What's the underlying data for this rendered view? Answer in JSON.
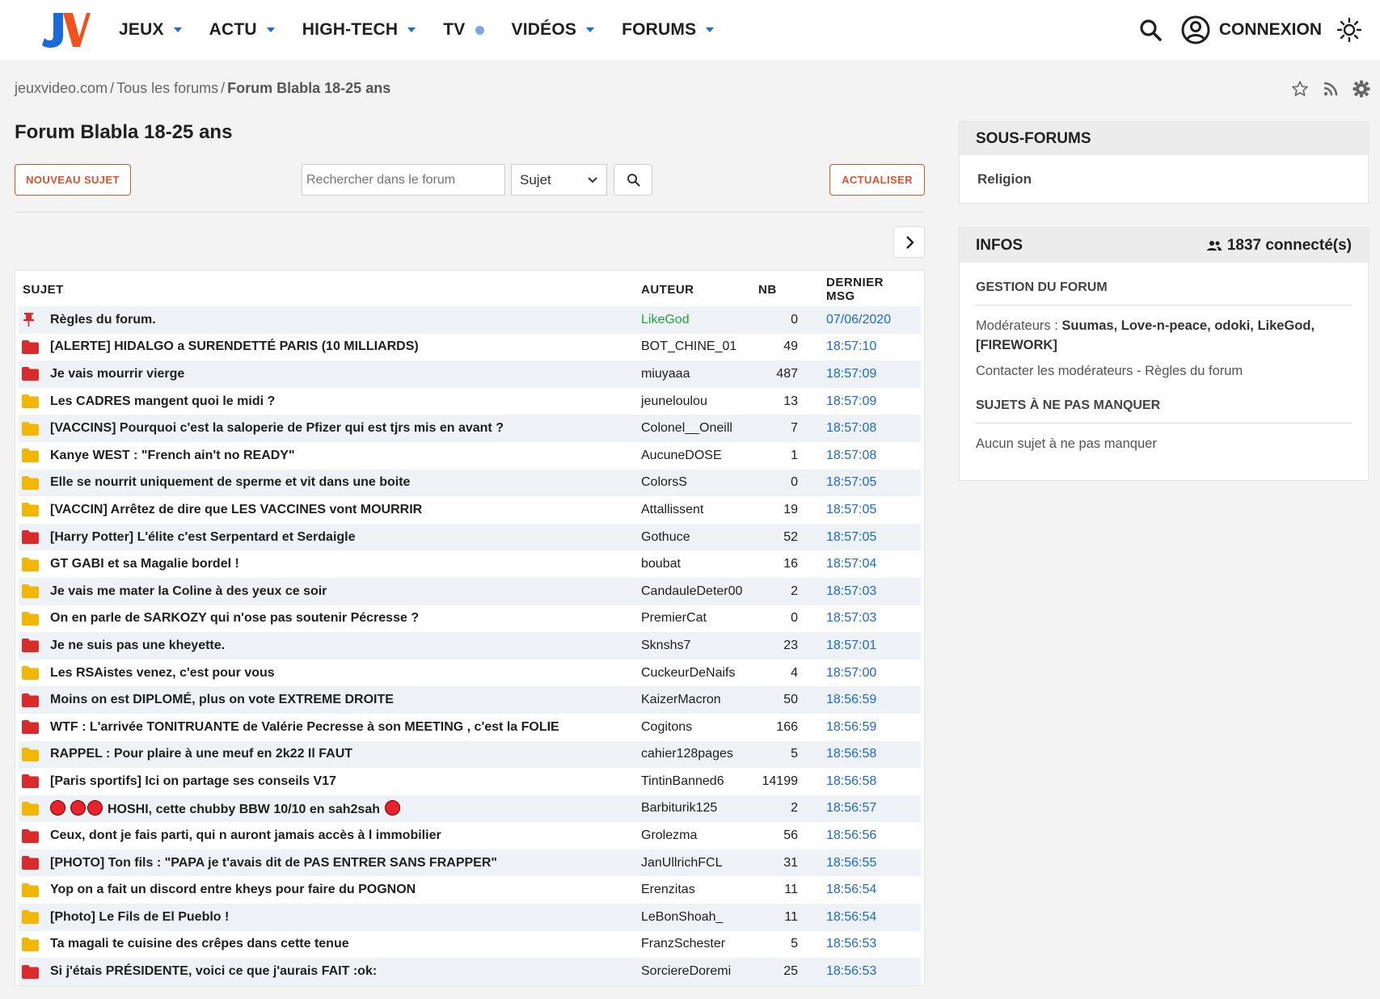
{
  "header": {
    "logo_text": "JV",
    "nav": [
      {
        "label": "JEUX",
        "marker": "caret"
      },
      {
        "label": "ACTU",
        "marker": "caret"
      },
      {
        "label": "HIGH-TECH",
        "marker": "caret"
      },
      {
        "label": "TV",
        "marker": "dot"
      },
      {
        "label": "VIDÉOS",
        "marker": "caret"
      },
      {
        "label": "FORUMS",
        "marker": "caret"
      }
    ],
    "login_label": "CONNEXION",
    "icons": [
      "search-icon",
      "user-icon",
      "sun-icon"
    ],
    "accent_color": "#1a6ad8"
  },
  "breadcrumb": {
    "items": [
      "jeuxvideo.com",
      "Tous les forums"
    ],
    "separator": "/",
    "current": "Forum Blabla 18-25 ans"
  },
  "page_title": "Forum Blabla 18-25 ans",
  "controls": {
    "new_topic": "NOUVEAU SUJET",
    "search_placeholder": "Rechercher dans le forum",
    "search_mode": "Sujet",
    "refresh": "ACTUALISER",
    "button_color": "#e0522b"
  },
  "table": {
    "headers": {
      "subject": "SUJET",
      "author": "AUTEUR",
      "count": "NB",
      "last": "DERNIER MSG"
    },
    "rows": [
      {
        "icon": "pin",
        "subject": "Règles du forum.",
        "author": "LikeGod",
        "count": "0",
        "last": "07/06/2020",
        "author_color": "green"
      },
      {
        "icon": "red",
        "subject": "[ALERTE] HIDALGO a SURENDETTÉ PARIS (10 MILLIARDS)",
        "author": "BOT_CHINE_01",
        "count": "49",
        "last": "18:57:10"
      },
      {
        "icon": "red",
        "subject": "Je vais mourrir vierge",
        "author": "miuyaaa",
        "count": "487",
        "last": "18:57:09"
      },
      {
        "icon": "yellow",
        "subject": "Les CADRES mangent quoi le midi ?",
        "author": "jeuneloulou",
        "count": "13",
        "last": "18:57:09"
      },
      {
        "icon": "yellow",
        "subject": "[VACCINS] Pourquoi c'est la saloperie de Pfizer qui est tjrs mis en avant ?",
        "author": "Colonel__Oneill",
        "count": "7",
        "last": "18:57:08"
      },
      {
        "icon": "yellow",
        "subject": "Kanye WEST : \"French ain't no READY\"",
        "author": "AucuneDOSE",
        "count": "1",
        "last": "18:57:08"
      },
      {
        "icon": "yellow",
        "subject": "Elle se nourrit uniquement de sperme et vit dans une boite",
        "author": "ColorsS",
        "count": "0",
        "last": "18:57:05"
      },
      {
        "icon": "yellow",
        "subject": "[VACCIN] Arrêtez de dire que LES VACCINES vont MOURRIR",
        "author": "Attallissent",
        "count": "19",
        "last": "18:57:05"
      },
      {
        "icon": "red",
        "subject": "[Harry Potter] L'élite c'est Serpentard et Serdaigle",
        "author": "Gothuce",
        "count": "52",
        "last": "18:57:05"
      },
      {
        "icon": "yellow",
        "subject": "GT GABI et sa Magalie bordel !",
        "author": "boubat",
        "count": "16",
        "last": "18:57:04"
      },
      {
        "icon": "yellow",
        "subject": "Je vais me mater la Coline à des yeux ce soir",
        "author": "CandauleDeter00",
        "count": "2",
        "last": "18:57:03"
      },
      {
        "icon": "yellow",
        "subject": "On en parle de SARKOZY qui n'ose pas soutenir Pécresse ?",
        "author": "PremierCat",
        "count": "0",
        "last": "18:57:03"
      },
      {
        "icon": "red",
        "subject": "Je ne suis pas une kheyette.",
        "author": "Sknshs7",
        "count": "23",
        "last": "18:57:01"
      },
      {
        "icon": "yellow",
        "subject": "Les RSAistes venez, c'est pour vous",
        "author": "CuckeurDeNaifs",
        "count": "4",
        "last": "18:57:00"
      },
      {
        "icon": "red",
        "subject": "Moins on est DIPLOMÉ, plus on vote EXTREME DROITE",
        "author": "KaizerMacron",
        "count": "50",
        "last": "18:56:59"
      },
      {
        "icon": "red",
        "subject": "WTF : L'arrivée TONITRUANTE de Valérie Pecresse à son MEETING , c'est la FOLIE",
        "author": "Cogitons",
        "count": "166",
        "last": "18:56:59"
      },
      {
        "icon": "yellow",
        "subject": "RAPPEL : Pour plaire à une meuf en 2k22 Il FAUT",
        "author": "cahier128pages",
        "count": "5",
        "last": "18:56:58"
      },
      {
        "icon": "red",
        "subject": "[Paris sportifs] Ici on partage ses conseils V17",
        "author": "TintinBanned6",
        "count": "14199",
        "last": "18:56:58"
      },
      {
        "icon": "yellow",
        "subject": "HOSHI, cette chubby BBW 10/10 en sah2sah",
        "author": "Barbiturik125",
        "count": "2",
        "last": "18:56:57",
        "emoji_prefix": 3,
        "emoji_suffix": 1
      },
      {
        "icon": "red",
        "subject": "Ceux, dont je fais parti, qui n auront jamais accès à l immobilier",
        "author": "Grolezma",
        "count": "56",
        "last": "18:56:56"
      },
      {
        "icon": "red",
        "subject": "[PHOTO] Ton fils : \"PAPA je t'avais dit de PAS ENTRER SANS FRAPPER\"",
        "author": "JanUllrichFCL",
        "count": "31",
        "last": "18:56:55"
      },
      {
        "icon": "yellow",
        "subject": "Yop on a fait un discord entre kheys pour faire du POGNON",
        "author": "Erenzitas",
        "count": "11",
        "last": "18:56:54"
      },
      {
        "icon": "yellow",
        "subject": "[Photo] Le Fils de El Pueblo !",
        "author": "LeBonShoah_",
        "count": "11",
        "last": "18:56:54"
      },
      {
        "icon": "yellow",
        "subject": "Ta magali te cuisine des crêpes dans cette tenue",
        "author": "FranzSchester",
        "count": "5",
        "last": "18:56:53"
      },
      {
        "icon": "red",
        "subject": "Si j'étais PRÉSIDENTE, voici ce que j'aurais FAIT :ok:",
        "author": "SorciereDoremi",
        "count": "25",
        "last": "18:56:53"
      }
    ]
  },
  "sidebar": {
    "subforums": {
      "title": "SOUS-FORUMS",
      "items": [
        "Religion"
      ]
    },
    "infos": {
      "title": "INFOS",
      "connected": "1837 connecté(s)",
      "management_title": "GESTION DU FORUM",
      "moderators_label": "Modérateurs :",
      "moderators": "Suumas, Love-n-peace, odoki, LikeGod, [FIREWORK]",
      "contact": "Contacter les modérateurs",
      "contact_sep": " - ",
      "rules": "Règles du forum",
      "must_see_title": "SUJETS À NE PAS MANQUER",
      "must_see_empty": "Aucun sujet à ne pas manquer"
    }
  },
  "colors": {
    "folder_red": "#d92b2b",
    "folder_yellow": "#f2b705",
    "pin": "#d92b2b",
    "link_blue": "#1a6ad8",
    "author_green": "#22a33d"
  }
}
